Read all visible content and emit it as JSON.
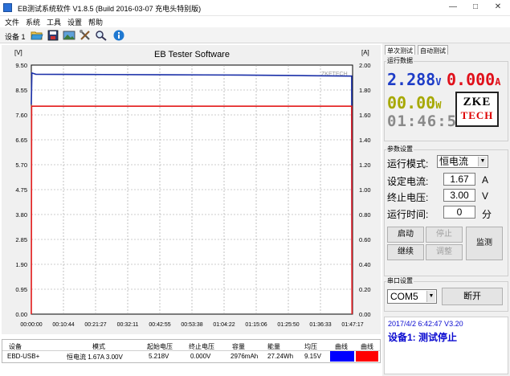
{
  "window": {
    "title": "EB测试系统软件 V1.8.5 (Build 2016-03-07 充电头特别版)",
    "controls": {
      "minimize": "—",
      "maximize": "□",
      "close": "✕"
    }
  },
  "menu": [
    "文件",
    "系统",
    "工具",
    "设置",
    "帮助"
  ],
  "toolbar": {
    "device_label": "设备 1",
    "icons": [
      "open-folder-icon",
      "save-icon",
      "image-icon",
      "tools-icon",
      "search-icon",
      "info-icon"
    ]
  },
  "chart_data": {
    "type": "line",
    "title": "EB Tester Software",
    "left_unit": "[V]",
    "right_unit": "[A]",
    "watermark": "ZKETECH",
    "ylim_left": [
      0.0,
      9.5
    ],
    "ylim_right": [
      0.0,
      2.0
    ],
    "y_ticks_left": [
      "9.50",
      "8.55",
      "7.60",
      "6.65",
      "5.70",
      "4.75",
      "3.80",
      "2.85",
      "1.90",
      "0.95",
      "0.00"
    ],
    "y_ticks_right": [
      "2.00",
      "1.80",
      "1.60",
      "1.40",
      "1.20",
      "1.00",
      "0.80",
      "0.60",
      "0.40",
      "0.20",
      "0.00"
    ],
    "x_ticks": [
      "00:00:00",
      "00:10:44",
      "00:21:27",
      "00:32:11",
      "00:42:55",
      "00:53:38",
      "01:04:22",
      "01:15:06",
      "01:25:50",
      "01:36:33",
      "01:47:17"
    ],
    "grid": true,
    "series": [
      {
        "axis": "left",
        "color": "#1a2fa8",
        "x_minutes": [
          0.0,
          0.2,
          1.5,
          20,
          45,
          70,
          90,
          107.0,
          107.1
        ],
        "values": [
          8.0,
          9.2,
          9.15,
          9.14,
          9.13,
          9.12,
          9.1,
          9.08,
          0.0
        ]
      },
      {
        "axis": "right",
        "color": "#e31b1b",
        "x_minutes": [
          0.0,
          0.1,
          0.3,
          107.0,
          107.1
        ],
        "values": [
          0.0,
          1.67,
          1.67,
          1.67,
          0.0
        ]
      }
    ]
  },
  "table": {
    "headers": [
      "设备",
      "模式",
      "起始电压",
      "终止电压",
      "容量",
      "能量",
      "均压",
      "曲线",
      "曲线"
    ],
    "row": {
      "device": "EBD-USB+",
      "mode": "恒电流 1.67A 3.00V",
      "start_voltage": "5.218V",
      "end_voltage": "0.000V",
      "capacity": "2976mAh",
      "energy": "27.24Wh",
      "avg_voltage": "9.15V"
    },
    "curve_colors": [
      "#0000ff",
      "#ff0000"
    ]
  },
  "tabs": [
    "单次测试",
    "自动测试"
  ],
  "run_data": {
    "title": "运行数据",
    "voltage": "2.288",
    "voltage_unit": "V",
    "current": "0.000",
    "current_unit": "A",
    "power": "00.00",
    "power_unit": "W",
    "time": "01:46:57",
    "logo_line1": "ZKE",
    "logo_line2": "TECH"
  },
  "params": {
    "title": "参数设置",
    "mode_label": "运行模式:",
    "mode_value": "恒电流",
    "current_label": "设定电流:",
    "current_value": "1.67",
    "current_unit": "A",
    "voltage_label": "终止电压:",
    "voltage_value": "3.00",
    "voltage_unit": "V",
    "time_label": "运行时间:",
    "time_value": "0",
    "time_unit": "分"
  },
  "buttons": {
    "start": "启动",
    "stop": "停止",
    "continue": "继续",
    "adjust": "调整",
    "monitor": "监测"
  },
  "serial": {
    "title": "串口设置",
    "port": "COM5",
    "disconnect": "断开"
  },
  "status": {
    "line1": "2017/4/2 6:42:47 V3.20",
    "line2": "设备1: 测试停止"
  }
}
